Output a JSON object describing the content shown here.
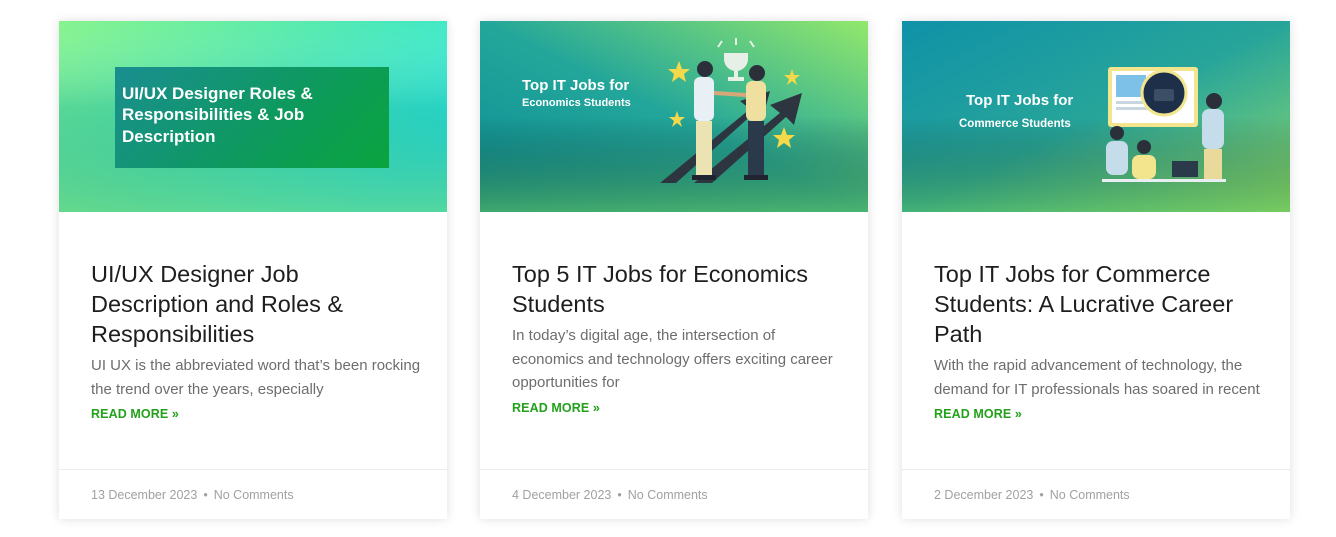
{
  "cards": [
    {
      "image": {
        "lines": [
          "UI/UX Designer Roles &",
          "Responsibilities & Job",
          "Description"
        ]
      },
      "title": "UI/UX Designer Job Description and Roles & Responsibilities",
      "excerpt": "UI UX is the abbreviated word that’s been rocking the trend over the years, especially",
      "read_more": "READ MORE »",
      "date": "13 December 2023",
      "separator": "•",
      "comments": "No Comments"
    },
    {
      "image": {
        "line1": "Top IT Jobs for",
        "line2": "Economics Students"
      },
      "title": "Top 5 IT Jobs for Economics Students",
      "excerpt": "In today’s digital age, the intersection of economics and technology offers exciting career opportunities for",
      "read_more": "READ MORE »",
      "date": "4 December 2023",
      "separator": "•",
      "comments": "No Comments"
    },
    {
      "image": {
        "line1": "Top IT Jobs for",
        "line2": "Commerce Students"
      },
      "title": "Top IT Jobs for Commerce Students: A Lucrative Career Path",
      "excerpt": "With the rapid advancement of technology, the demand for IT professionals has soared in recent",
      "read_more": "READ MORE »",
      "date": "2 December 2023",
      "separator": "•",
      "comments": "No Comments"
    }
  ],
  "colors": {
    "accent_green": "#22a11b",
    "title_text": "#1e1e1e",
    "body_text": "#6d6d6d",
    "meta_text": "#a1a1a1"
  }
}
